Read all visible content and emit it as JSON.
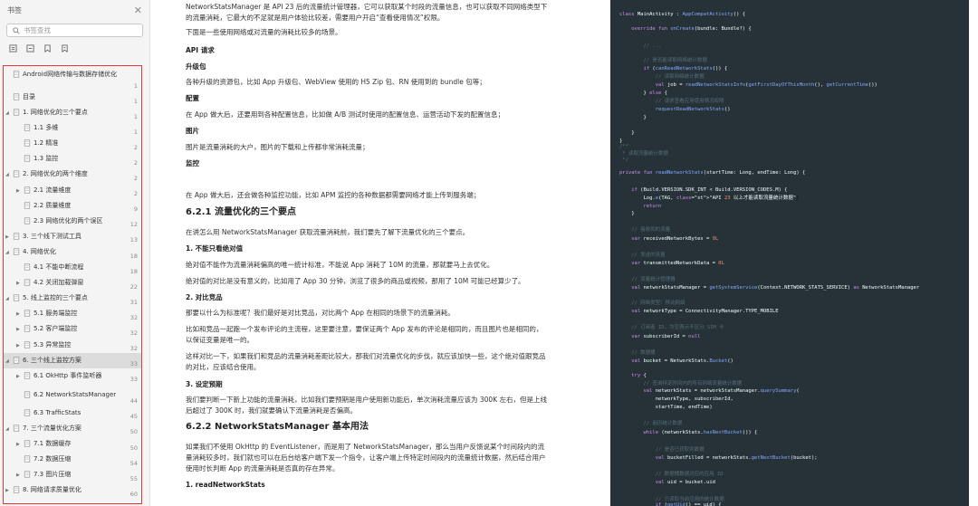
{
  "sidebar": {
    "title": "书签",
    "search_placeholder": "书签查找",
    "toc": [
      {
        "label": "Android网络传输与数据存储优化",
        "page": "1",
        "arrow": "",
        "level": 0
      },
      {
        "label": "目录",
        "page": "1",
        "arrow": "",
        "level": 0
      },
      {
        "label": "1. 网络优化的三个要点",
        "page": "1",
        "arrow": "▲",
        "level": 0
      },
      {
        "label": "1.1 多维",
        "page": "1",
        "arrow": "",
        "level": 1
      },
      {
        "label": "1.2 精准",
        "page": "2",
        "arrow": "",
        "level": 1
      },
      {
        "label": "1.3 监控",
        "page": "2",
        "arrow": "",
        "level": 1
      },
      {
        "label": "2. 网络优化的两个维度",
        "page": "2",
        "arrow": "▲",
        "level": 0
      },
      {
        "label": "2.1 流量维度",
        "page": "2",
        "arrow": "▶",
        "level": 1
      },
      {
        "label": "2.2 质量维度",
        "page": "9",
        "arrow": "",
        "level": 1
      },
      {
        "label": "2.3 网络优化的两个误区",
        "page": "12",
        "arrow": "",
        "level": 1
      },
      {
        "label": "3. 三个线下测试工具",
        "page": "13",
        "arrow": "▶",
        "level": 0
      },
      {
        "label": "4. 网络优化",
        "page": "18",
        "arrow": "▲",
        "level": 0
      },
      {
        "label": "4.1 不能中断流程",
        "page": "18",
        "arrow": "",
        "level": 1
      },
      {
        "label": "4.2 关闭加载弹窗",
        "page": "22",
        "arrow": "▶",
        "level": 1
      },
      {
        "label": "5. 线上监控的三个要点",
        "page": "31",
        "arrow": "▲",
        "level": 0
      },
      {
        "label": "5.1 服务端监控",
        "page": "32",
        "arrow": "▶",
        "level": 1
      },
      {
        "label": "5.2 客户端监控",
        "page": "32",
        "arrow": "▶",
        "level": 1
      },
      {
        "label": "5.3 异常监控",
        "page": "32",
        "arrow": "▶",
        "level": 1
      },
      {
        "label": "6. 三个线上监控方案",
        "page": "33",
        "arrow": "▲",
        "level": 0,
        "active": true
      },
      {
        "label": "6.1 OkHttp 事件监听器",
        "page": "33",
        "arrow": "▶",
        "level": 1
      },
      {
        "label": "6.2 NetworkStatsManager",
        "page": "44",
        "arrow": "",
        "level": 1,
        "tall": true
      },
      {
        "label": "6.3 TrafficStats",
        "page": "45",
        "arrow": "",
        "level": 1
      },
      {
        "label": "7. 三个流量优化方案",
        "page": "50",
        "arrow": "▲",
        "level": 0
      },
      {
        "label": "7.1 数据缓存",
        "page": "50",
        "arrow": "▶",
        "level": 1
      },
      {
        "label": "7.2 数据压缩",
        "page": "54",
        "arrow": "",
        "level": 1
      },
      {
        "label": "7.3 图片压缩",
        "page": "55",
        "arrow": "▶",
        "level": 1
      },
      {
        "label": "8. 网络请求质量优化",
        "page": "60",
        "arrow": "▶",
        "level": 0
      }
    ]
  },
  "doc": {
    "intro": "NetworkStatsManager 是 API 23 后的流量统计管理器，它可以获取某个时段的流量信息，也可以获取不同网络类型下的流量消耗，它最大的不足就是用户体验比较差，需要用户开启“查看使用情况”权限。",
    "scene_intro": "下面是一些使用网络或对流量的消耗比较多的场景。",
    "h_api": "API 请求",
    "h_upgrade": "升级包",
    "p_upgrade": "各种升级的资源包，比如 App 升级包、WebView 使用的 H5 Zip 包、RN 使用到的 bundle 包等；",
    "h_config": "配置",
    "p_config": "在 App 做大后，还要用到各种配置信息，比如做 A/B 测试时使用的配置信息、运营活动下发的配置信息；",
    "h_image": "图片",
    "p_image": "图片是流量消耗的大户，图片的下载和上传都非常消耗流量；",
    "h_monitor": "监控",
    "p_monitor": "在 App 做大后，还会做各种监控功能，比如 APM 监控的各种数据都需要网络才能上传到服务端；",
    "h621": "6.2.1 流量优化的三个要点",
    "p621": "在讲怎么用 NetworkStatsManager 获取流量消耗前，我们要先了解下流量优化的三个要点。",
    "h_p1": "1. 不能只看绝对值",
    "p_p1a": "绝对值不能作为流量消耗偏高的唯一统计标准，不能说 App 消耗了 10M 的流量，那就要马上去优化。",
    "p_p1b": "绝对值的对比是没有意义的，比如用了 App 30 分钟，浏览了很多的商品或视频，那用了 10M 可能已经算少了。",
    "h_p2": "2. 对比竞品",
    "p_p2a": "那要以什么为标准呢？我们最好是对比竞品，对比两个 App 在相同的场景下的流量消耗。",
    "p_p2b": "比如和竞品一起跑一个发布评论的主流程，这里要注意，要保证两个 App 发布的评论是相同的，而且图片也是相同的，以保证变量是唯一的。",
    "p_p2c": "这样对比一下，如果我们和竞品的流量消耗差距比较大，那我们对流量优化的步伐，就应该加快一些，这个绝对值跟竞品的对比，应该结合使用。",
    "h_p3": "3. 设定预期",
    "p_p3": "我们要判断一下新上功能的流量消耗，比如我们要预期是用户使用新功能后，单次消耗流量应该为 300K 左右，但是上线后超过了 300K 时，我们就要确认下流量消耗是否偏高。",
    "h622": "6.2.2 NetworkStatsManager 基本用法",
    "p622": "如果我们不使用 OkHttp 的 EventListener，而是用了 NetworkStatsManager，那么当用户反馈说某个时间段内的流量消耗较多时，我们就也可以在后台给客户端下发一个指令，让客户端上传特定时间段内的流量统计数据，然后结合用户使用时长判断 App 的流量消耗是否真的存在异常。",
    "h_read": "1. readNetworkStats"
  },
  "code": {
    "lines": [
      "class MainActivity : AppCompatActivity() {",
      "    override fun onCreate(bundle: Bundle?) {",
      "        // ...",
      "        // 是否能读取网络统计数据",
      "        if (canReadNetworkStats()) {",
      "            // 读取网络统计数据",
      "            val job = readNetworkStatsInfo(getFirstDayOfThisMonth(), getCurrentTime())",
      "        } else {",
      "            // 请求查看应用使用情况权限",
      "            requestReadNetworkStats()",
      "        }",
      "    }",
      "}",
      "/**",
      " * 读取流量统计数据",
      " */",
      "private fun readNetworkStats(startTime: Long, endTime: Long) {",
      "    if (Build.VERSION.SDK_INT < Build.VERSION_CODES.M) {",
      "        Log.e(TAG, \"API 23 以上才能读取流量统计数据\")",
      "        return",
      "    }",
      "    // 接收到的流量",
      "    var receivedNetworkBytes = 0L",
      "    // 发送的流量",
      "    var transmittedNetworkData = 0L",
      "    // 流量统计管理器",
      "    val networkStatsManager = getSystemService(Context.NETWORK_STATS_SERVICE) as NetworkStatsManager",
      "    // 网络类型：移动网络",
      "    val networkType = ConnectivityManager.TYPE_MOBILE",
      "    // 订阅者 ID，为空表示不区分 SIM 卡",
      "    var subscriberId = null",
      "    // 数据桶",
      "    val bucket = NetworkStats.Bucket()",
      "    try {",
      "        // 查询特定时间内的所有网络流量统计数据",
      "        val networkStats = networkStatsManager.querySummary(",
      "            networkType, subscriberId,",
      "            startTime, endTime)",
      "        // 遍历统计数据",
      "        while (networkStats.hasNextBucket()) {",
      "            // 是否已获取到数据",
      "            val bucketFilled = networkStats.getNextBucket(bucket);",
      "            // 数据桶数据对应的应用 ID",
      "            val uid = bucket.uid",
      "            // 只读取当前应用的统计数据",
      "            if (getUid() == uid) {"
    ]
  }
}
